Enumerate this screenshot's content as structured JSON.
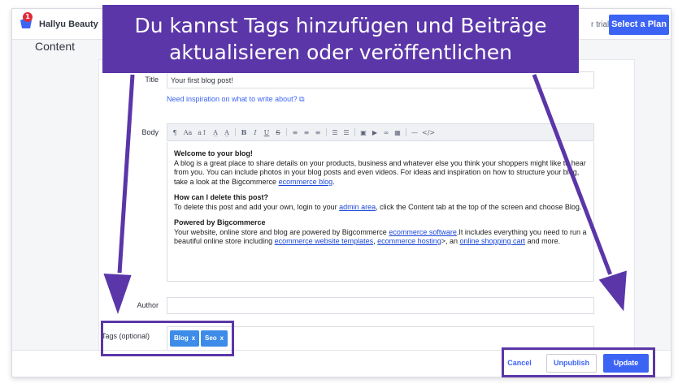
{
  "app": {
    "store_name": "Hallyu Beauty",
    "notification_count": "1",
    "trial_text": "r trial.",
    "plan_button": "Select a Plan"
  },
  "page": {
    "title": "Content"
  },
  "form": {
    "title_label": "Title",
    "title_value": "Your first blog post!",
    "inspiration_link": "Need inspiration on what to write about?",
    "body_label": "Body",
    "author_label": "Author",
    "author_value": "",
    "tags_label": "Tags (optional)"
  },
  "toolbar": {
    "icons": [
      "paragraph-icon",
      "font-family-icon",
      "font-size-icon",
      "text-color-icon",
      "highlight-icon",
      "bold-icon",
      "italic-icon",
      "underline-icon",
      "strikethrough-icon",
      "align-left-icon",
      "align-center-icon",
      "align-right-icon",
      "bullet-list-icon",
      "numbered-list-icon",
      "image-icon",
      "video-icon",
      "link-icon",
      "table-icon",
      "horizontal-rule-icon",
      "code-view-icon"
    ],
    "glyphs": [
      "¶",
      "Aa",
      "a↕",
      "A̲",
      "A̲",
      "B",
      "I",
      "U",
      "S",
      "≡",
      "≡",
      "≡",
      "☰",
      "☰",
      "▣",
      "▶",
      "∞",
      "▦",
      "—",
      "</>"
    ]
  },
  "editor": {
    "welcome_heading": "Welcome to your blog!",
    "welcome_text_1": "A blog is a great place to share details on your products, business and whatever else you think your shoppers might like to hear from you. You can include photos in your blog posts and even videos. For ideas and inspiration on how to structure your blog, take a look at the Bigcommerce ",
    "welcome_link": "ecommerce blog",
    "welcome_text_2": ".",
    "delete_heading": "How can I delete this post?",
    "delete_text_1": "To delete this post and add your own, login to your ",
    "delete_link": "admin area",
    "delete_text_2": ", click the Content tab at the top of the screen and choose Blog.",
    "powered_heading": "Powered by Bigcommerce",
    "powered_text_1": "Your website, online store and blog are powered by Bigcommerce ",
    "powered_link_1": "ecommerce software",
    "powered_text_2": ".It includes everything you need to run a beautiful online store including ",
    "powered_link_2": "ecommerce website templates",
    "powered_text_3": ", ",
    "powered_link_3": "ecommerce hosting",
    "powered_text_4": ">, an ",
    "powered_link_4": "online shopping cart",
    "powered_text_5": " and more."
  },
  "tags": [
    {
      "label": "Blog",
      "remove": "x"
    },
    {
      "label": "Seo",
      "remove": "x"
    }
  ],
  "actions": {
    "cancel": "Cancel",
    "unpublish": "Unpublish",
    "update": "Update"
  },
  "overlay": {
    "banner_line_1": "Du kannst Tags hinzufügen und Beiträge",
    "banner_line_2": "aktualisieren oder veröffentlichen"
  },
  "colors": {
    "accent": "#3c64f4",
    "annotation": "#5b36a8",
    "tag": "#3c8ce8",
    "notification": "#e02b38"
  }
}
